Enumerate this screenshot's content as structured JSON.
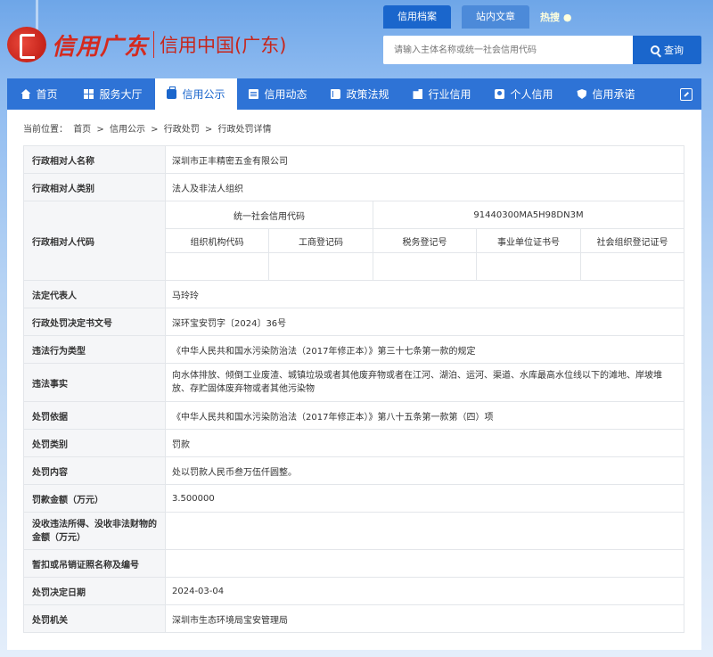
{
  "header": {
    "logo_cursive": "信用广东",
    "logo_main": "信用中国(广东)",
    "tabs": [
      "信用档案",
      "站内文章"
    ],
    "hot_label": "热搜",
    "search_placeholder": "请输入主体名称或统一社会信用代码",
    "search_button": "查询"
  },
  "nav": {
    "items": [
      {
        "label": "首页",
        "icon": "home-icon"
      },
      {
        "label": "服务大厅",
        "icon": "grid-icon"
      },
      {
        "label": "信用公示",
        "icon": "briefcase-icon"
      },
      {
        "label": "信用动态",
        "icon": "document-icon"
      },
      {
        "label": "政策法规",
        "icon": "book-icon"
      },
      {
        "label": "行业信用",
        "icon": "building-icon"
      },
      {
        "label": "个人信用",
        "icon": "user-card-icon"
      },
      {
        "label": "信用承诺",
        "icon": "shield-icon"
      }
    ],
    "active_index": 2
  },
  "breadcrumb": {
    "prefix": "当前位置：",
    "items": [
      "首页",
      "信用公示",
      "行政处罚",
      "行政处罚详情"
    ],
    "separator": ">"
  },
  "detail": {
    "name_label": "行政相对人名称",
    "name_value": "深圳市正丰精密五金有限公司",
    "type_label": "行政相对人类别",
    "type_value": "法人及非法人组织",
    "code_label": "行政相对人代码",
    "uscc_label": "统一社会信用代码",
    "uscc_value": "91440300MA5H98DN3M",
    "sub_headers": [
      "组织机构代码",
      "工商登记码",
      "税务登记号",
      "事业单位证书号",
      "社会组织登记证号"
    ],
    "legal_rep_label": "法定代表人",
    "legal_rep_value": "马玲玲",
    "doc_no_label": "行政处罚决定书文号",
    "doc_no_value": "深环宝安罚字〔2024〕36号",
    "violation_type_label": "违法行为类型",
    "violation_type_value": "《中华人民共和国水污染防治法（2017年修正本）》第三十七条第一款的规定",
    "facts_label": "违法事实",
    "facts_value": "向水体排放、倾倒工业废渣、城镇垃圾或者其他废弃物或者在江河、湖泊、运河、渠道、水库最高水位线以下的滩地、岸坡堆放、存贮固体废弃物或者其他污染物",
    "basis_label": "处罚依据",
    "basis_value": "《中华人民共和国水污染防治法（2017年修正本）》第八十五条第一款第（四）项",
    "category_label": "处罚类别",
    "category_value": "罚款",
    "content_label": "处罚内容",
    "content_value": "处以罚款人民币叁万伍仟圆整。",
    "amount_label": "罚款金额（万元）",
    "amount_value": "3.500000",
    "confiscate_label": "没收违法所得、没收非法财物的金额（万元）",
    "confiscate_value": "",
    "license_label": "暂扣或吊销证照名称及编号",
    "license_value": "",
    "date_label": "处罚决定日期",
    "date_value": "2024-03-04",
    "org_label": "处罚机关",
    "org_value": "深圳市生态环境局宝安管理局"
  }
}
